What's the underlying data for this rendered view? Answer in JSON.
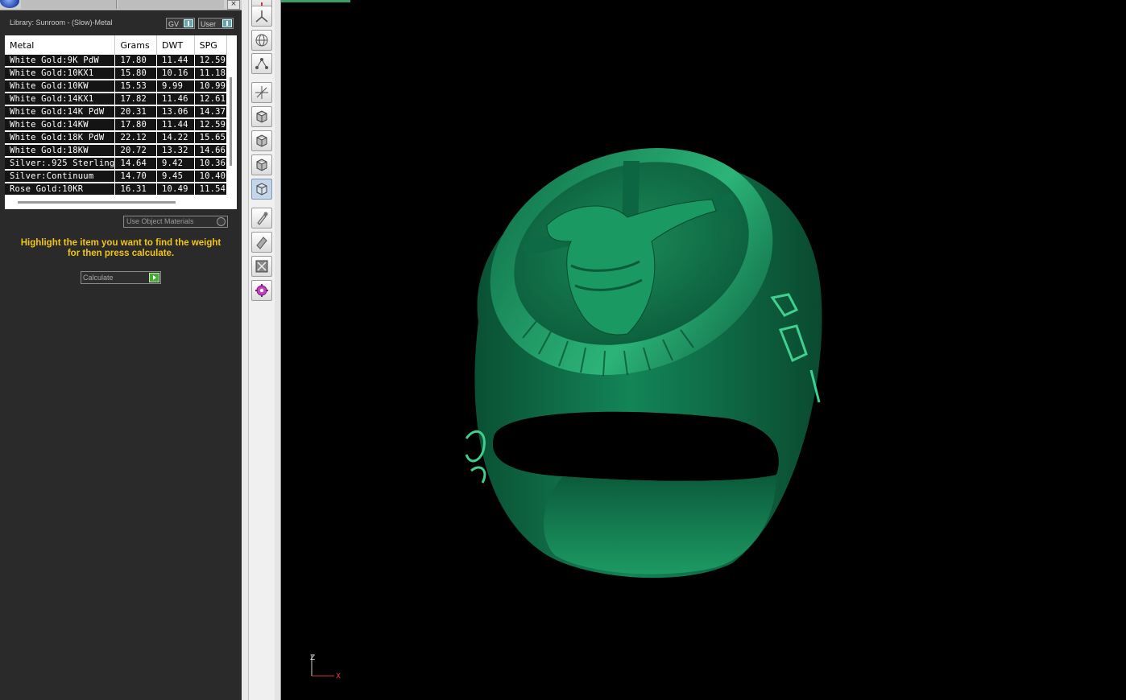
{
  "library": {
    "label": "Library: Sunroom - (Slow)-Metal",
    "toggle_gv": "GV",
    "toggle_user": "User"
  },
  "table": {
    "headers": [
      "Metal",
      "Grams",
      "DWT",
      "SPG"
    ],
    "rows": [
      [
        "White Gold:9K PdW",
        "17.80",
        "11.44",
        "12.59"
      ],
      [
        "White Gold:10KX1",
        "15.80",
        "10.16",
        "11.18"
      ],
      [
        "White Gold:10KW",
        "15.53",
        "9.99",
        "10.99"
      ],
      [
        "White Gold:14KX1",
        "17.82",
        "11.46",
        "12.61"
      ],
      [
        "White Gold:14K PdW",
        "20.31",
        "13.06",
        "14.37"
      ],
      [
        "White Gold:14KW",
        "17.80",
        "11.44",
        "12.59"
      ],
      [
        "White Gold:18K PdW",
        "22.12",
        "14.22",
        "15.65"
      ],
      [
        "White Gold:18KW",
        "20.72",
        "13.32",
        "14.66"
      ],
      [
        "Silver:.925 Sterling",
        "14.64",
        "9.42",
        "10.36"
      ],
      [
        "Silver:Continuum",
        "14.70",
        "9.45",
        "10.40"
      ],
      [
        "Rose Gold:10KR",
        "16.31",
        "10.49",
        "11.54"
      ]
    ]
  },
  "use_object_materials": "Use Object Materials",
  "instruction": {
    "line1": "Highlight the item you want to find the weight",
    "line2": "for then press calculate."
  },
  "calculate_label": "Calculate",
  "toolbar": {
    "icons": [
      "pointer-star-icon",
      "axis-tripod-icon",
      "globe-icon",
      "node-graph-icon",
      "move-axes-icon",
      "cube-front-icon",
      "cube-top-icon",
      "cube-side-icon",
      "cube-iso-icon",
      "eyedropper-icon",
      "paint-brush-icon",
      "grid-cancel-icon",
      "gear-multi-icon"
    ]
  },
  "viewport": {
    "object": "ring-model",
    "axis_labels": {
      "z": "Z",
      "x": "X"
    }
  },
  "colors": {
    "ring": "#0e6b45",
    "ring_highlight": "#2fb37a",
    "panel": "#2a2a2a",
    "instruction": "#f2c417"
  }
}
